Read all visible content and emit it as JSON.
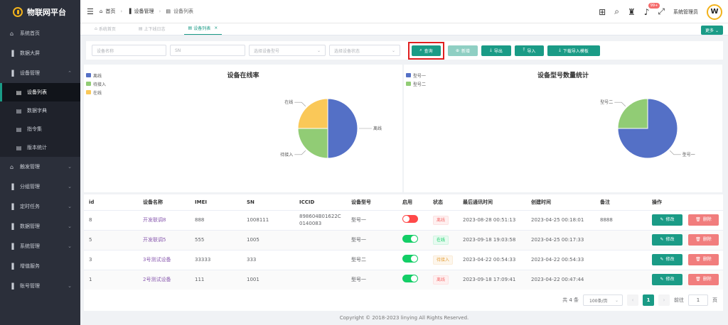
{
  "brand": {
    "title": "物联网平台"
  },
  "sidebar": {
    "items": [
      {
        "label": "系统首页",
        "icon": "home-icon"
      },
      {
        "label": "数据大屏",
        "icon": "bar-chart-icon"
      },
      {
        "label": "设备管理",
        "icon": "bar-chart-icon"
      },
      {
        "label": "设备列表",
        "icon": "doc-icon"
      },
      {
        "label": "数据字典",
        "icon": "doc-icon"
      },
      {
        "label": "指令集",
        "icon": "doc-icon"
      },
      {
        "label": "版本统计",
        "icon": "doc-icon"
      },
      {
        "label": "触发管理",
        "icon": "lock-icon"
      },
      {
        "label": "分组管理",
        "icon": "bar-chart-icon"
      },
      {
        "label": "定时任务",
        "icon": "bar-chart-icon"
      },
      {
        "label": "数据管理",
        "icon": "bar-chart-icon"
      },
      {
        "label": "系统管理",
        "icon": "bar-chart-icon"
      },
      {
        "label": "增值服务",
        "icon": "bar-chart-icon"
      },
      {
        "label": "账号管理",
        "icon": "bar-chart-icon"
      }
    ]
  },
  "header": {
    "breadcrumb": [
      "首页",
      "设备管理",
      "设备列表"
    ],
    "badge": "99+",
    "username": "系统管理员",
    "avatar_letter": "W"
  },
  "tabs": {
    "items": [
      "系统首页",
      "上下线日志",
      "设备列表"
    ],
    "more": "更多"
  },
  "filters": {
    "device_name_placeholder": "设备名称",
    "sn_placeholder": "SN",
    "model_placeholder": "选择设备型号",
    "status_placeholder": "选择设备状态"
  },
  "actions": {
    "query": "查询",
    "add": "新增",
    "export": "导出",
    "import": "导入",
    "download_template": "下载导入模板"
  },
  "chart_data": [
    {
      "type": "pie",
      "title": "设备在线率",
      "categories": [
        "离线",
        "待接入",
        "在线"
      ],
      "values": [
        2,
        1,
        1
      ],
      "colors": [
        "#5470c6",
        "#91cc75",
        "#fac858"
      ]
    },
    {
      "type": "pie",
      "title": "设备型号数量统计",
      "categories": [
        "型号一",
        "型号二"
      ],
      "values": [
        3,
        1
      ],
      "colors": [
        "#5470c6",
        "#91cc75"
      ]
    }
  ],
  "table": {
    "headers": [
      "id",
      "设备名称",
      "IMEI",
      "SN",
      "ICCID",
      "设备型号",
      "启用",
      "状态",
      "最后通讯时间",
      "创建时间",
      "备注",
      "操作"
    ],
    "rows": [
      {
        "id": "8",
        "name": "开发联调8",
        "imei": "888",
        "sn": "1008111",
        "iccid": "898604B01622C0140083",
        "model": "型号一",
        "enabled": false,
        "status": "离线",
        "status_kind": "offline",
        "last_comm": "2023-08-28 00:51:13",
        "created": "2023-04-25 00:18:01",
        "remark": "8888"
      },
      {
        "id": "5",
        "name": "开发联调5",
        "imei": "555",
        "sn": "1005",
        "iccid": "",
        "model": "型号一",
        "enabled": true,
        "status": "在线",
        "status_kind": "online",
        "last_comm": "2023-09-18 19:03:58",
        "created": "2023-04-25 00:17:33",
        "remark": ""
      },
      {
        "id": "3",
        "name": "3号测试设备",
        "imei": "33333",
        "sn": "333",
        "iccid": "",
        "model": "型号二",
        "enabled": true,
        "status": "待接入",
        "status_kind": "pending",
        "last_comm": "2023-04-22 00:54:33",
        "created": "2023-04-22 00:54:33",
        "remark": ""
      },
      {
        "id": "1",
        "name": "2号测试设备",
        "imei": "111",
        "sn": "1001",
        "iccid": "",
        "model": "型号一",
        "enabled": true,
        "status": "离线",
        "status_kind": "offline",
        "last_comm": "2023-09-18 17:09:41",
        "created": "2023-04-22 00:47:44",
        "remark": ""
      }
    ],
    "edit_label": "修改",
    "delete_label": "删除"
  },
  "pagination": {
    "total": "共 4 条",
    "page_size": "100条/页",
    "current_page": "1",
    "goto_label": "前往",
    "goto_value": "1",
    "page_unit": "页"
  },
  "footer": {
    "copyright": "Copyright © 2018-2023 linying All Rights Reserved."
  }
}
